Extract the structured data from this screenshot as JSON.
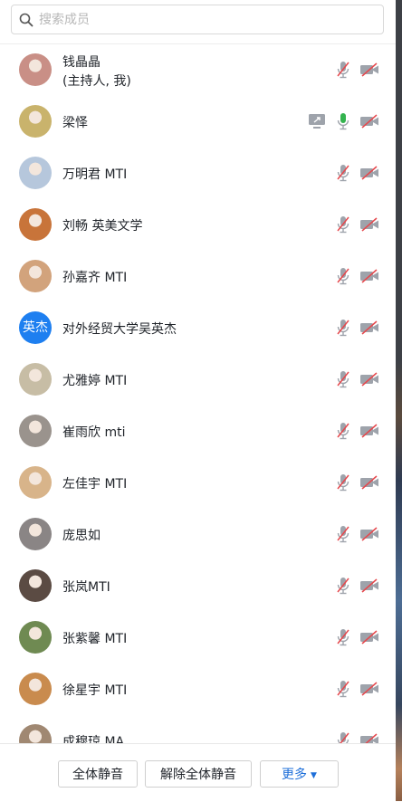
{
  "search": {
    "placeholder": "搜索成员",
    "value": ""
  },
  "members": [
    {
      "name": "钱晶晶",
      "subtitle": "(主持人, 我)",
      "avatar": "photo",
      "avatar_color": "#c98f86",
      "screen_share": false,
      "mic": "muted",
      "camera": "off"
    },
    {
      "name": "梁怿",
      "avatar": "photo",
      "avatar_color": "#c9b36c",
      "screen_share": true,
      "mic": "on",
      "camera": "off"
    },
    {
      "name": "万明君 MTI",
      "avatar": "photo",
      "avatar_color": "#b6c7dc",
      "screen_share": false,
      "mic": "muted",
      "camera": "off"
    },
    {
      "name": "刘畅 英美文学",
      "avatar": "photo",
      "avatar_color": "#c8743a",
      "screen_share": false,
      "mic": "muted",
      "camera": "off"
    },
    {
      "name": "孙嘉齐 MTI",
      "avatar": "photo",
      "avatar_color": "#d2a37c",
      "screen_share": false,
      "mic": "muted",
      "camera": "off"
    },
    {
      "name": "对外经贸大学吴英杰",
      "avatar": "text",
      "avatar_text": "英杰",
      "avatar_color": "#1e7ff0",
      "screen_share": false,
      "mic": "muted",
      "camera": "off"
    },
    {
      "name": "尤雅婷 MTI",
      "avatar": "photo",
      "avatar_color": "#c7bda5",
      "screen_share": false,
      "mic": "muted",
      "camera": "off"
    },
    {
      "name": "崔雨欣 mti",
      "avatar": "photo",
      "avatar_color": "#9a938d",
      "screen_share": false,
      "mic": "muted",
      "camera": "off"
    },
    {
      "name": "左佳宇 MTI",
      "avatar": "photo",
      "avatar_color": "#d8b48a",
      "screen_share": false,
      "mic": "muted",
      "camera": "off"
    },
    {
      "name": "庞思如",
      "avatar": "photo",
      "avatar_color": "#8a8585",
      "screen_share": false,
      "mic": "muted",
      "camera": "off"
    },
    {
      "name": "张岚MTI",
      "avatar": "photo",
      "avatar_color": "#5b4b43",
      "screen_share": false,
      "mic": "muted",
      "camera": "off"
    },
    {
      "name": "张紫馨 MTI",
      "avatar": "photo",
      "avatar_color": "#6f8a52",
      "screen_share": false,
      "mic": "muted",
      "camera": "off"
    },
    {
      "name": "徐星宇 MTI",
      "avatar": "photo",
      "avatar_color": "#c98b4e",
      "screen_share": false,
      "mic": "muted",
      "camera": "off"
    },
    {
      "name": "成穆琼 MA",
      "avatar": "photo",
      "avatar_color": "#a08872",
      "screen_share": false,
      "mic": "muted",
      "camera": "off"
    }
  ],
  "footer": {
    "mute_all": "全体静音",
    "unmute_all": "解除全体静音",
    "more": "更多"
  },
  "colors": {
    "muted_red": "#e5484d",
    "icon_grey": "#9ea3ab",
    "mic_green": "#34b34f",
    "accent_blue": "#1e6fd9"
  }
}
